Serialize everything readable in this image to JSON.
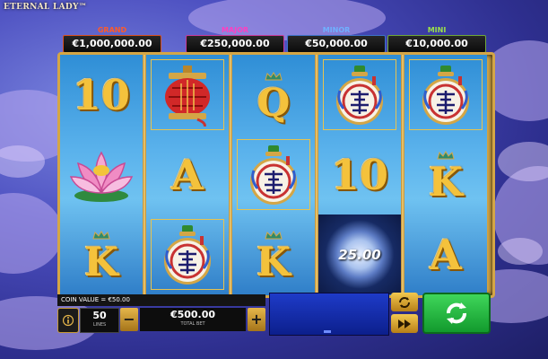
{
  "game": {
    "title": "ETERNAL LADY™"
  },
  "jackpots": [
    {
      "label": "GRAND",
      "value": "€1,000,000.00"
    },
    {
      "label": "MAJOR",
      "value": "€250,000.00"
    },
    {
      "label": "MINOR",
      "value": "€50,000.00"
    },
    {
      "label": "MINI",
      "value": "€10,000.00"
    }
  ],
  "reels": [
    [
      "10",
      "lantern",
      "Q",
      "vase",
      "vase"
    ],
    [
      "lotus",
      "A",
      "vase",
      "10",
      "K"
    ],
    [
      "K",
      "vase",
      "K",
      "moon",
      "A"
    ]
  ],
  "symbols": {
    "ten": "10",
    "queen": "Q",
    "ace": "A",
    "king": "K",
    "lantern": "lantern-icon",
    "vase": "vase-icon",
    "lotus": "lotus-icon",
    "moon": "moon-icon"
  },
  "moon_value": "25.00",
  "controls": {
    "coin_value": "COIN VALUE = €50.00",
    "lines_value": "50",
    "lines_label": "LINES",
    "minus": "−",
    "plus": "+",
    "total_bet_value": "€500.00",
    "total_bet_label": "TOTAL BET"
  },
  "colors": {
    "grand": "#ff5a2a",
    "major": "#ff3fc0",
    "minor": "#6fb0ff",
    "mini": "#9be04a",
    "spin": "#2dbb45",
    "gold": "#d4a646"
  }
}
